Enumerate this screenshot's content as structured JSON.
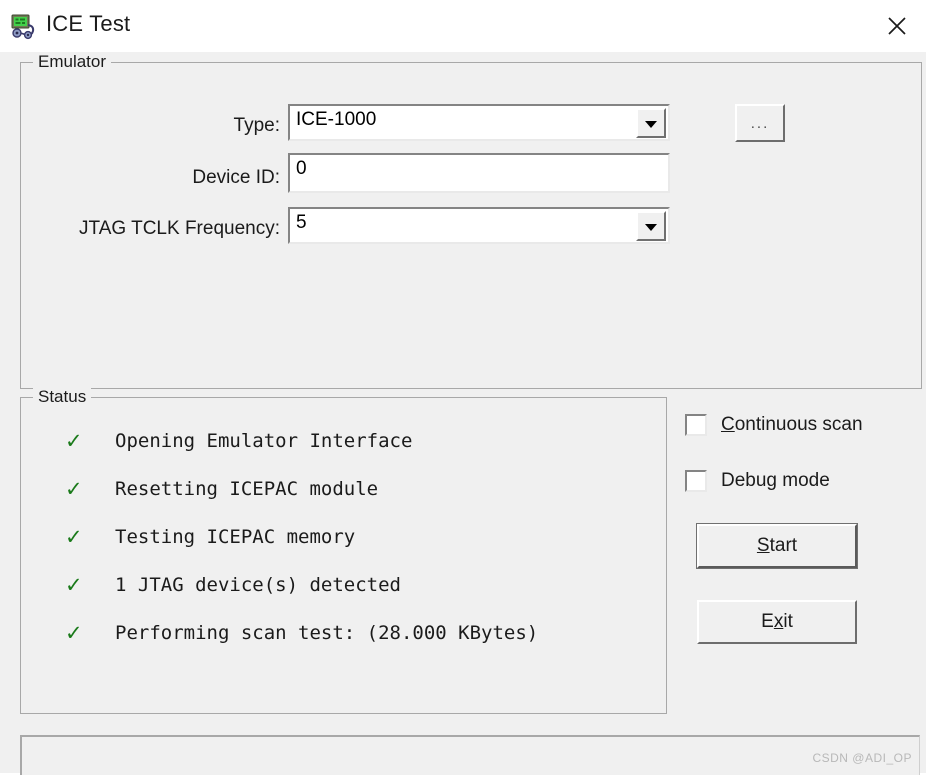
{
  "window": {
    "title": "ICE Test",
    "icon": "ice-device-icon",
    "close_label": "✕"
  },
  "emulator": {
    "group_title": "Emulator",
    "fields": [
      {
        "label": "Type:",
        "value": "ICE-1000",
        "control": "combobox"
      },
      {
        "label": "Device ID:",
        "value": "0",
        "control": "textbox"
      },
      {
        "label": "JTAG TCLK Frequency:",
        "value": "5",
        "control": "combobox"
      }
    ],
    "browse_button": "..."
  },
  "status": {
    "group_title": "Status",
    "check_glyph": "✓",
    "check_color": "#1a7a1a",
    "items": [
      "Opening Emulator Interface",
      "Resetting ICEPAC module",
      "Testing ICEPAC memory",
      "1 JTAG device(s) detected",
      "Performing scan test: (28.000 KBytes)"
    ]
  },
  "options": {
    "continuous_scan": {
      "label_pre": "",
      "accel": "C",
      "label_post": "ontinuous scan",
      "checked": false
    },
    "debug_mode": {
      "label_pre": "Debug mode",
      "accel": "",
      "label_post": "",
      "checked": false
    }
  },
  "actions": {
    "start": {
      "pre": "",
      "accel": "S",
      "post": "tart"
    },
    "exit": {
      "pre": "E",
      "accel": "x",
      "post": "it"
    }
  },
  "watermark": "CSDN @ADI_OP"
}
